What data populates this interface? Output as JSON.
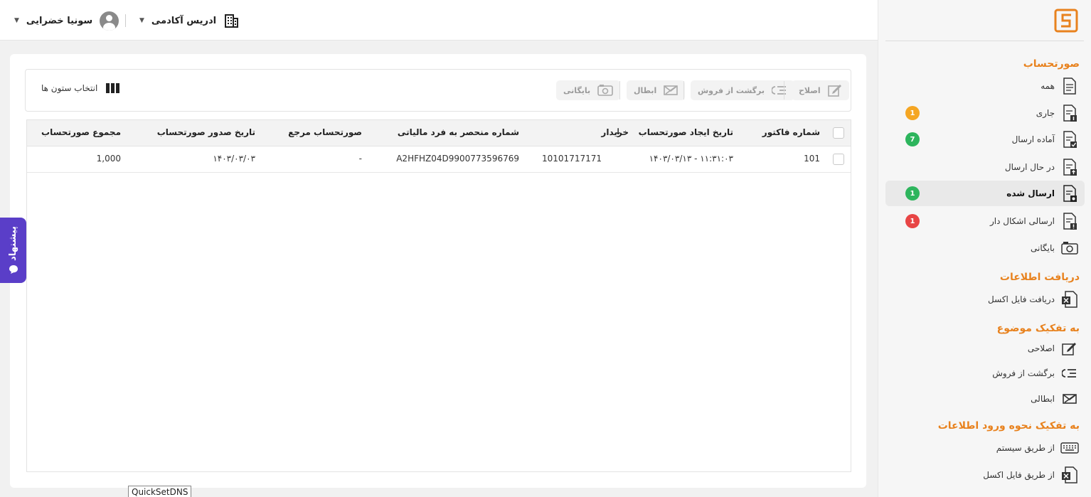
{
  "header": {
    "user_name": "سونیا خضرایی",
    "company_name": "ادریس آکادمی"
  },
  "sidebar": {
    "sections": [
      {
        "title": "صورتحساب"
      },
      {
        "title": "دریافت اطلاعات"
      },
      {
        "title": "به تفکیک موضوع"
      },
      {
        "title": "به تفکیک نحوه ورود اطلاعات"
      }
    ],
    "items": [
      {
        "label": "همه",
        "icon": "document-icon"
      },
      {
        "label": "جاری",
        "icon": "document-info-icon",
        "badge": "1",
        "badge_color": "#f5a623"
      },
      {
        "label": "آماده ارسال",
        "icon": "document-check-icon",
        "badge": "7",
        "badge_color": "#2db55d"
      },
      {
        "label": "در حال ارسال",
        "icon": "document-send-icon"
      },
      {
        "label": "ارسال شده",
        "icon": "document-sent-icon",
        "badge": "1",
        "badge_color": "#2db55d"
      },
      {
        "label": "ارسالی اشکال دار",
        "icon": "document-error-icon",
        "badge": "1",
        "badge_color": "#e84545"
      },
      {
        "label": "بایگانی",
        "icon": "archive-icon"
      },
      {
        "label": "دریافت فایل اکسل",
        "icon": "excel-icon"
      },
      {
        "label": "اصلاحی",
        "icon": "edit-icon"
      },
      {
        "label": "برگشت از فروش",
        "icon": "return-icon"
      },
      {
        "label": "ابطالی",
        "icon": "cancel-icon"
      },
      {
        "label": "از طریق سیستم",
        "icon": "keyboard-icon"
      },
      {
        "label": "از طریق فایل اکسل",
        "icon": "excel-icon"
      }
    ]
  },
  "toolbar": {
    "correction_label": "اصلاح",
    "return_label": "برگشت از فروش",
    "cancel_label": "ابطال",
    "archive_label": "بایگانی",
    "column_select_label": "انتخاب ستون ها"
  },
  "table": {
    "columns": [
      "شماره فاکتور",
      "تاریخ ایجاد صورتحساب",
      "خریدار",
      "شماره منحصر به فرد مالیاتی",
      "صورتحساب مرجع",
      "تاریخ صدور صورتحساب",
      "مجموع صورتحساب"
    ],
    "sort_icon": "arrow-down-icon",
    "rows": [
      [
        "101",
        "۱۱:۳۱:۰۳ - ۱۴۰۳/۰۳/۱۳",
        "10101717171",
        "A2HFHZ04D9900773596769",
        "-",
        "۱۴۰۳/۰۳/۰۳",
        "1,000"
      ]
    ]
  },
  "feedback_label": "پیشنهاد",
  "quickset_label": "QuickSetDNS",
  "colors": {
    "accent": "#e8821e",
    "feedback": "#5a3ec8"
  }
}
